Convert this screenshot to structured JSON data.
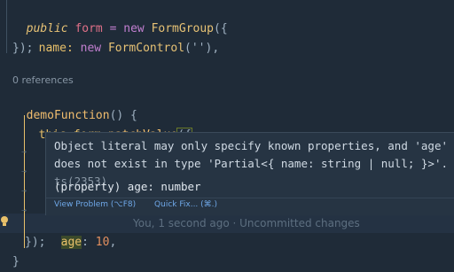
{
  "editor": {
    "line1": {
      "kw": "public",
      "ident": "form",
      "op": "=",
      "new": "new",
      "cls": "FormGroup",
      "tail": "({"
    },
    "line2": {
      "prop": "name:",
      "new": "new",
      "cls": "FormControl",
      "tail": "(''),",
      "str": "''"
    },
    "line3": {
      "text": "});"
    },
    "codelens": "0 references",
    "line5": {
      "fn": "demoFunction",
      "tail": "() {"
    },
    "line6": {
      "this": "this",
      "dot1": ".",
      "prop1": "form",
      "dot2": ".",
      "method": "patchValue",
      "tail": "({"
    },
    "line_age": {
      "key": "age",
      "colon": ":",
      "num": "10",
      "comma": ","
    },
    "blame": "You, 1 second ago · Uncommitted changes",
    "line_close1": {
      "text": "});"
    },
    "line_close2": {
      "text": "}"
    }
  },
  "hover": {
    "message": "Object literal may only specify known properties, and 'age' does not exist in type 'Partial<{ name: string | null; }>'.",
    "ts_code": "ts(2353)",
    "signature_prefix": "(property)",
    "signature_name": "age",
    "signature_type": ": number",
    "action_view": "View Problem (⌥F8)",
    "action_fix": "Quick Fix... (⌘.)"
  },
  "icons": {
    "bulb": "lightbulb-icon"
  }
}
